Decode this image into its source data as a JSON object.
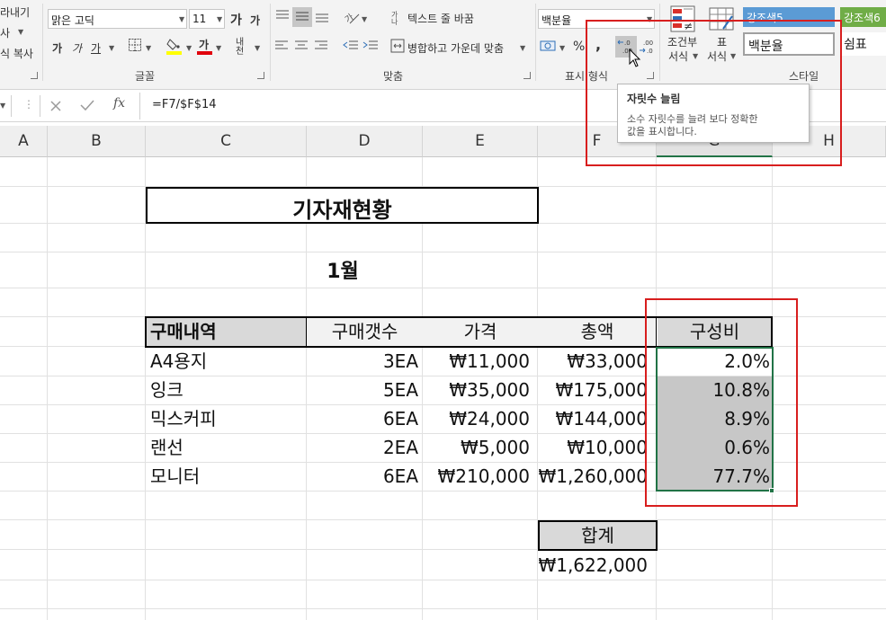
{
  "ribbon": {
    "clipboard": {
      "cut_label": "라내기",
      "copy_label": "사",
      "format_painter_label": "식 복사"
    },
    "font": {
      "font_name": "맑은 고딕",
      "font_size": "11",
      "increase_font_label": "가",
      "decrease_font_label": "가",
      "bold_label": "가",
      "italic_label": "가",
      "underline_label": "가",
      "font_color_label": "가",
      "phonetic_label": "내천",
      "group_label": "글꼴"
    },
    "alignment": {
      "wrap_text_label": "텍스트 줄 바꿈",
      "merge_center_label": "병합하고 가운데 맞춤",
      "group_label": "맞춤"
    },
    "number": {
      "format_value": "백분율",
      "percent_label": "%",
      "comma_label": ",",
      "group_label": "표시 형식"
    },
    "styles": {
      "conditional_format_label_1": "조건부",
      "conditional_format_label_2": "서식",
      "format_table_label_1": "표",
      "format_table_label_2": "서식",
      "accent5_label": "강조색5",
      "accent6_label": "강조색6",
      "percent_style_label": "백분율",
      "comma_style_label": "쉼표",
      "group_label": "스타일"
    }
  },
  "tooltip": {
    "title": "자릿수 늘림",
    "body_line1": "소수 자릿수를 늘려 보다 정확한",
    "body_line2": "값을 표시합니다."
  },
  "formula_bar": {
    "fx_label": "fx",
    "formula": "=F7/$F$14"
  },
  "columns": [
    "A",
    "B",
    "C",
    "D",
    "E",
    "F",
    "G",
    "H"
  ],
  "sheet": {
    "title": "기자재현황",
    "month": "1월",
    "table_headers": [
      "구매내역",
      "구매갯수",
      "가격",
      "총액",
      "구성비"
    ],
    "rows": [
      {
        "item": "A4용지",
        "qty": "3EA",
        "price": "₩11,000",
        "total": "₩33,000",
        "ratio": "2.0%"
      },
      {
        "item": "잉크",
        "qty": "5EA",
        "price": "₩35,000",
        "total": "₩175,000",
        "ratio": "10.8%"
      },
      {
        "item": "믹스커피",
        "qty": "6EA",
        "price": "₩24,000",
        "total": "₩144,000",
        "ratio": "8.9%"
      },
      {
        "item": "랜선",
        "qty": "2EA",
        "price": "₩5,000",
        "total": "₩10,000",
        "ratio": "0.6%"
      },
      {
        "item": "모니터",
        "qty": "6EA",
        "price": "₩210,000",
        "total": "₩1,260,000",
        "ratio": "77.7%"
      }
    ],
    "sum_label": "합계",
    "sum_value": "₩1,622,000"
  },
  "colors": {
    "highlight_red": "#d81e1e",
    "accent5": "#5b9bd5",
    "accent6": "#70ad47",
    "selection_green": "#217346"
  }
}
